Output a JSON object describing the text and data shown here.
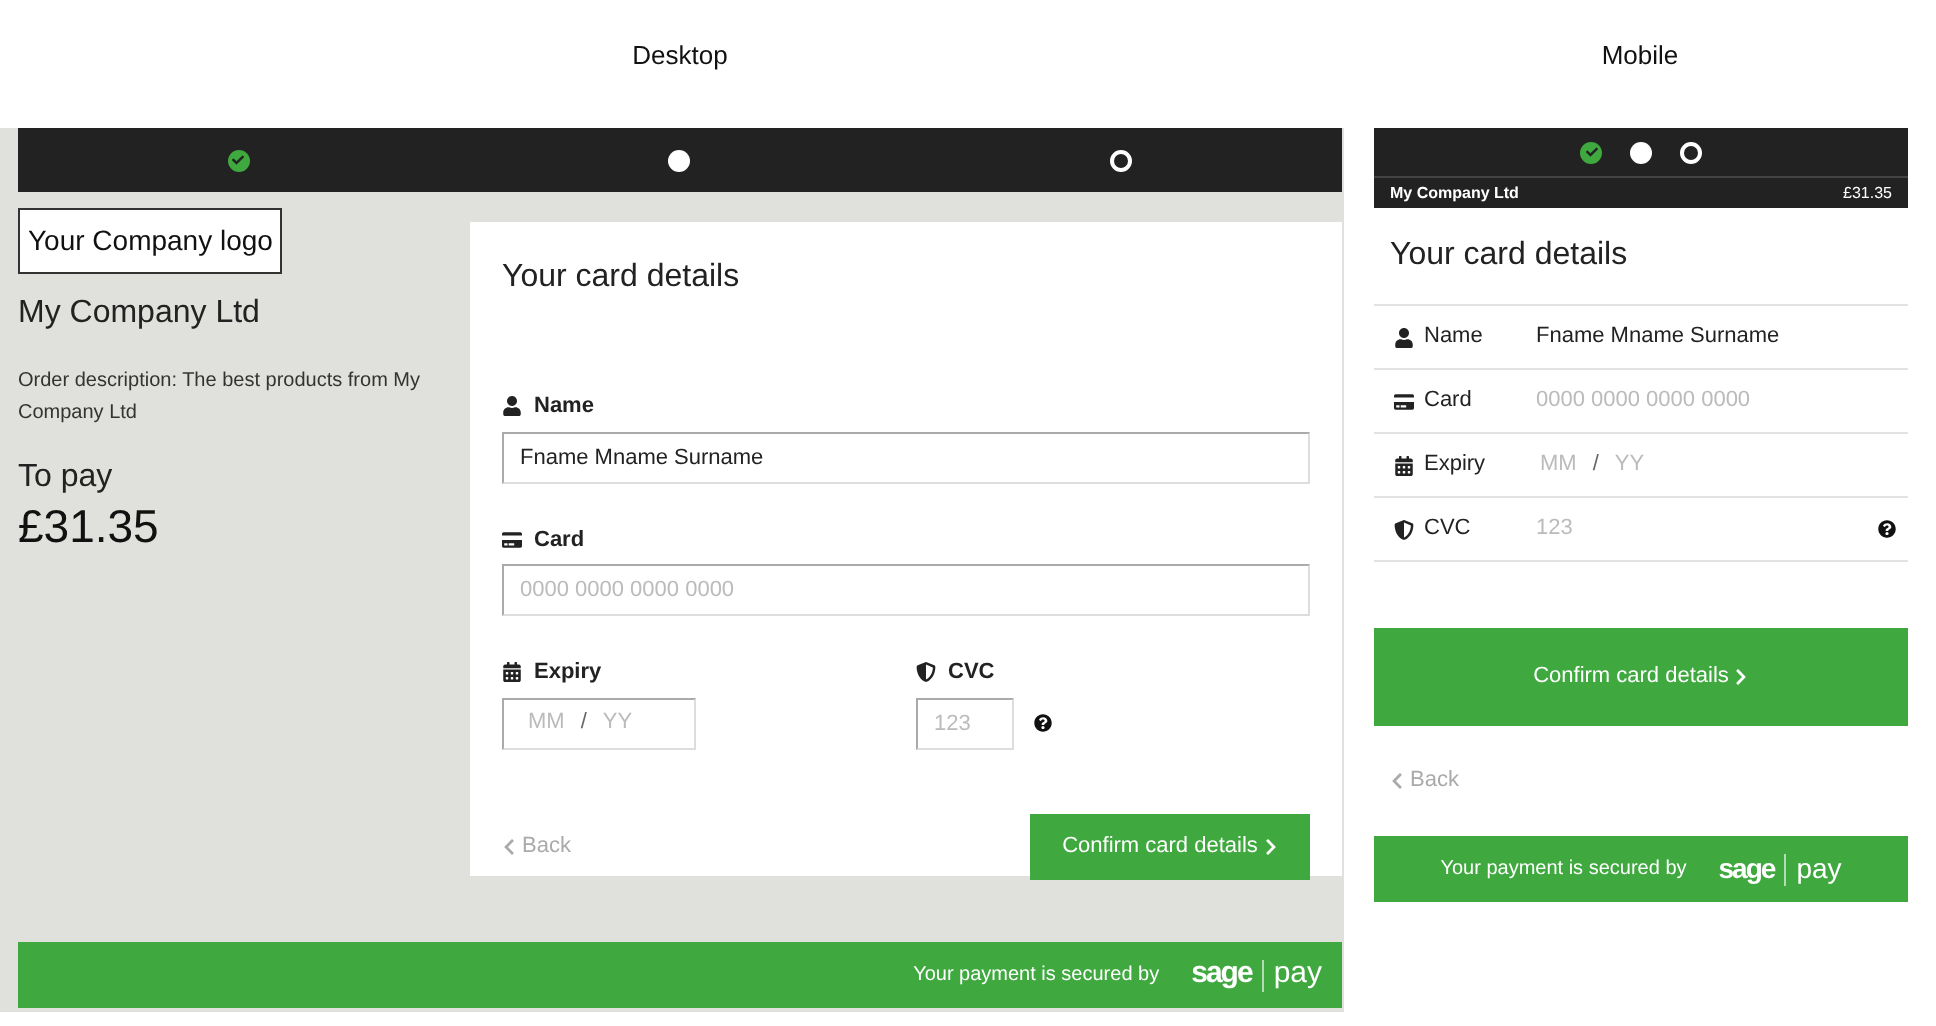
{
  "columns": [
    {
      "label": "Desktop"
    },
    {
      "label": "Mobile"
    }
  ],
  "desktop": {
    "steps": [
      {
        "completed": true,
        "selected": false
      },
      {
        "completed": false,
        "selected": true
      },
      {
        "completed": false,
        "selected": false
      }
    ],
    "logo": "Your Company logo",
    "company": "My Company Ltd",
    "order_description": "Order description: The best products from My Company Ltd",
    "to_pay_label": "To pay",
    "amount": "£31.35",
    "form": {
      "title": "Your card details",
      "fields": [
        {
          "kind": "name",
          "label": "Name",
          "value": "Fname Mname Surname"
        },
        {
          "kind": "card",
          "label": "Card",
          "placeholder": "0000 0000 0000 0000"
        },
        {
          "kind": "expiry",
          "label": "Expiry",
          "month_placeholder": "MM",
          "separator": "/",
          "year_placeholder": "YY"
        },
        {
          "kind": "cvc",
          "label": "CVC",
          "placeholder": "123"
        }
      ],
      "back": "Back",
      "confirm": "Confirm card details"
    },
    "footer": {
      "text": "Your payment is secured by",
      "logo_left": "sage",
      "logo_right": "pay"
    }
  },
  "mobile": {
    "steps": [
      {
        "completed": true,
        "selected": false
      },
      {
        "completed": false,
        "selected": true
      },
      {
        "completed": false,
        "selected": false
      }
    ],
    "company": "My Company Ltd",
    "amount": "£31.35",
    "form": {
      "title": "Your card details",
      "fields": [
        {
          "kind": "name",
          "label": "Name",
          "value": "Fname Mname Surname"
        },
        {
          "kind": "card",
          "label": "Card",
          "placeholder": "0000 0000 0000 0000"
        },
        {
          "kind": "expiry",
          "label": "Expiry",
          "month_placeholder": "MM",
          "separator": "/",
          "year_placeholder": "YY"
        },
        {
          "kind": "cvc",
          "label": "CVC",
          "placeholder": "123"
        }
      ],
      "confirm": "Confirm card details",
      "back": "Back"
    },
    "footer": {
      "text": "Your payment is secured by",
      "logo_left": "sage",
      "logo_right": "pay"
    }
  }
}
